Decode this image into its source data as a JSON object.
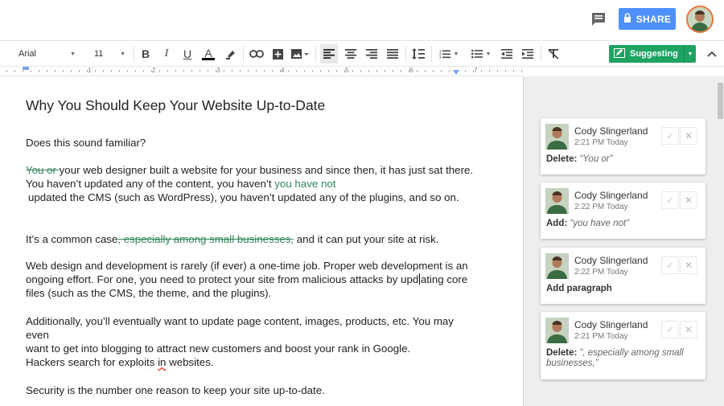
{
  "header": {
    "share_label": "SHARE",
    "icons": [
      "comment-icon",
      "lock-icon",
      "user-avatar"
    ]
  },
  "toolbar": {
    "font": "Arial",
    "size": "11",
    "mode_label": "Suggesting",
    "colors": {
      "suggest_green": "#1ea362",
      "share_blue": "#4d90fe",
      "suggestion_text": "#31865a"
    }
  },
  "ruler": {
    "numbers": [
      "1",
      "2",
      "3",
      "4",
      "5",
      "6",
      "7"
    ]
  },
  "document": {
    "title": "Why You Should Keep Your Website Up-to-Date",
    "p1": "Does this sound familiar?",
    "p2": {
      "del": "You or ",
      "a": "your web designer built a website for your business and since then, it has just sat there.",
      "b": "You haven’t updated any of the content, you haven’t ",
      "ins": "you have not",
      "c": "updated the CMS (such as WordPress), you haven’t updated any of the plugins, and so on."
    },
    "p3": {
      "a": "It’s a common case",
      "del": ", especially among small businesses,",
      "b": " and it can put your site at risk."
    },
    "p4": {
      "a": "Web design and development is rarely (if ever) a one-time job. Proper web development is an",
      "b": "ongoing effort. For one, you need to protect your site from malicious attacks by upd",
      "c": "ating core",
      "d": "files (such as the CMS, the theme, and the plugins)."
    },
    "p5": {
      "a": "Additionally, you’ll eventually want to update page content, images, products, etc. You may even",
      "b": "want to get into blogging to attract new customers and boost your rank in Google."
    },
    "p6": {
      "a": "Hackers search for exploits ",
      "typo": "in",
      "b": " websites."
    },
    "p7": "Security is the number one reason to keep your site up-to-date."
  },
  "suggestions": [
    {
      "author": "Cody Slingerland",
      "time": "2:21 PM Today",
      "kind": "Delete:",
      "text": "“You or”"
    },
    {
      "author": "Cody Slingerland",
      "time": "2:22 PM Today",
      "kind": "Add:",
      "text": "“you have not”"
    },
    {
      "author": "Cody Slingerland",
      "time": "2:22 PM Today",
      "kind": "Add paragraph",
      "text": ""
    },
    {
      "author": "Cody Slingerland",
      "time": "2:21 PM Today",
      "kind": "Delete:",
      "text": "“, especially among small businesses,”"
    }
  ]
}
